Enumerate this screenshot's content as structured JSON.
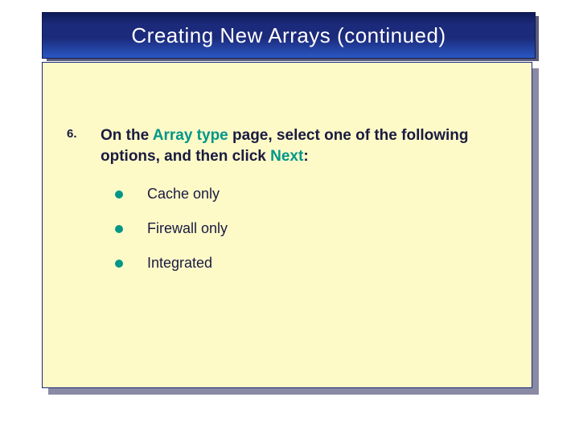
{
  "title": "Creating New Arrays (continued)",
  "step": {
    "number": "6.",
    "text_parts": {
      "p1": "On the ",
      "hl1": "Array type",
      "p2": " page, select one of the following options, and then click ",
      "hl2": "Next",
      "p3": ":"
    }
  },
  "bullets": [
    "Cache only",
    "Firewall only",
    "Integrated"
  ],
  "colors": {
    "title_gradient_top": "#0d1a57",
    "title_gradient_bottom": "#2a57c4",
    "body_bg": "#fdfac8",
    "highlight": "#009688",
    "body_text": "#1a1a40"
  }
}
